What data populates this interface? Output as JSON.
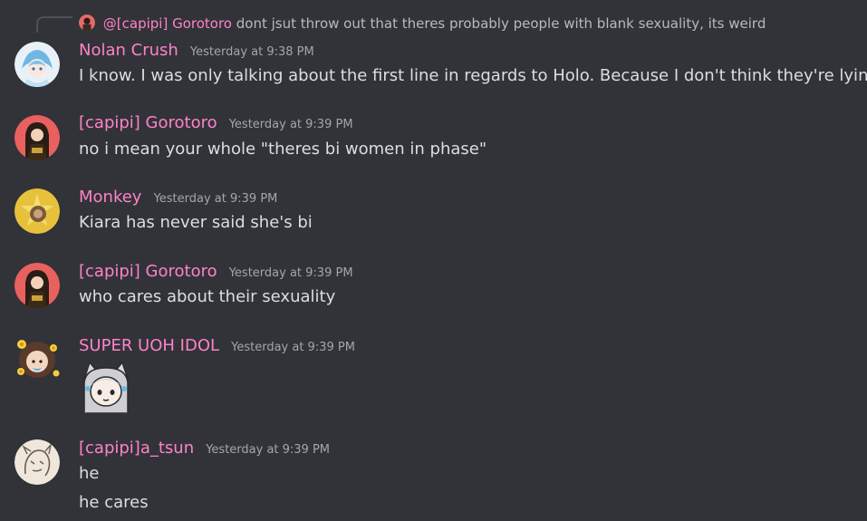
{
  "reply": {
    "author": "@[capipi] Gorotoro",
    "text": "dont jsut throw out that theres probably people with blank sexuality, its weird"
  },
  "messages": [
    {
      "author": "Nolan Crush",
      "timestamp": "Yesterday at 9:38 PM",
      "lines": [
        "I know. I was only talking about the first line in regards to Holo. Because I don't think they're lying"
      ]
    },
    {
      "author": "[capipi] Gorotoro",
      "timestamp": "Yesterday at 9:39 PM",
      "lines": [
        "no i mean your whole \"theres bi women in phase\""
      ]
    },
    {
      "author": "Monkey",
      "timestamp": "Yesterday at 9:39 PM",
      "lines": [
        "Kiara has never said she's bi"
      ]
    },
    {
      "author": "[capipi] Gorotoro",
      "timestamp": "Yesterday at 9:39 PM",
      "lines": [
        "who cares about their sexuality"
      ]
    },
    {
      "author": "SUPER UOH IDOL",
      "timestamp": "Yesterday at 9:39 PM",
      "lines": []
    },
    {
      "author": "[capipi]a_tsun",
      "timestamp": "Yesterday at 9:39 PM",
      "lines": [
        "he",
        "he cares"
      ]
    }
  ],
  "colors": {
    "background": "#313338",
    "author": "#ff82c8",
    "text": "#dbdee1",
    "timestamp": "#a3a6aa"
  }
}
